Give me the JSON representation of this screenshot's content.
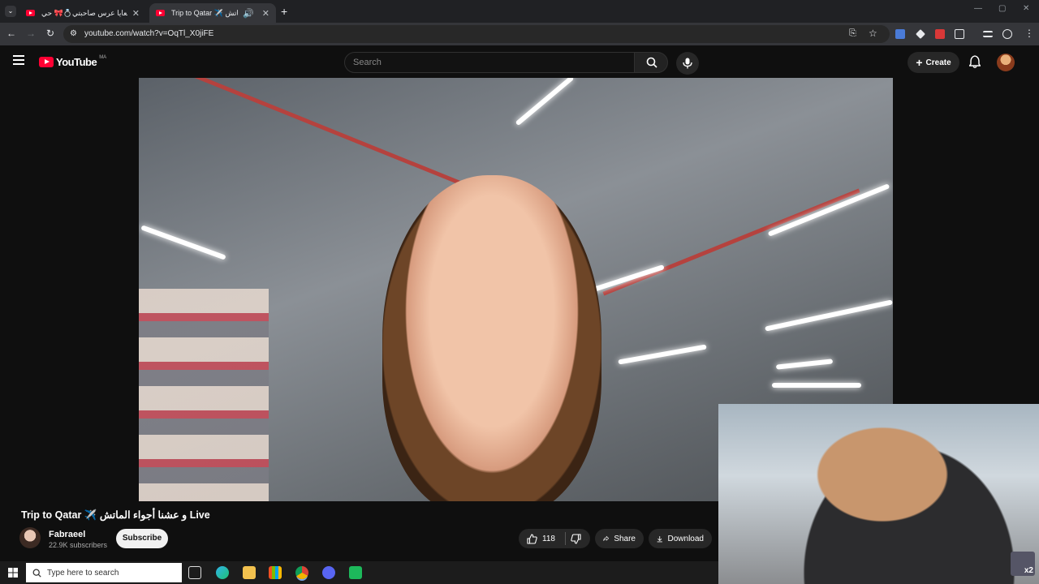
{
  "browser": {
    "tabs": [
      {
        "title": "دوزو معايا عرس صاحبتي💍🎀 حي...",
        "active": false
      },
      {
        "title": "Trip to Qatar ✈️ و عشنا أجواء الماتش",
        "active": true
      }
    ],
    "new_tab": "+",
    "url": "youtube.com/watch?v=OqTl_X0jiFE"
  },
  "youtube": {
    "logo_text": "YouTube",
    "region": "MA",
    "search_placeholder": "Search",
    "create_label": "Create"
  },
  "video": {
    "title": "Trip to Qatar ✈️ و عشنا أجواء الماتش Live",
    "channel": "Fabraeel",
    "subscribers": "22.9K subscribers",
    "subscribe_label": "Subscribe",
    "likes": "118",
    "share_label": "Share",
    "download_label": "Download"
  },
  "webcam": {
    "badge": "x2"
  },
  "taskbar": {
    "search_placeholder": "Type here to search"
  },
  "colors": {
    "yt_red": "#ff0033",
    "bg": "#0f0f0f",
    "chrome_dark": "#202124"
  }
}
